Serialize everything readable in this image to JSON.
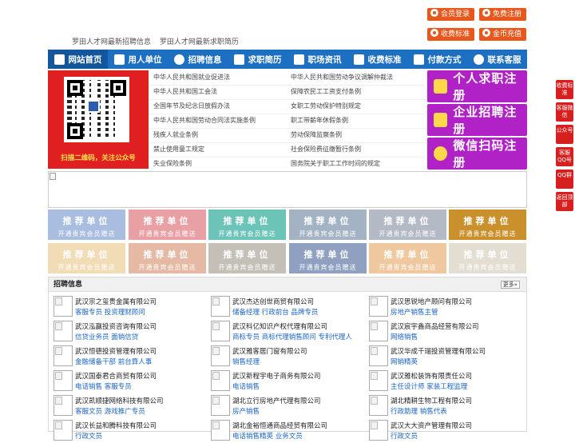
{
  "top": {
    "links": [
      "罗田人才网最新招聘信息",
      "罗田人才网最新求职简历"
    ],
    "buttons": {
      "member_login": "会员登录",
      "free_register": "免费注册",
      "pricing": "收费标准",
      "coin_recharge": "金币充值"
    }
  },
  "nav": {
    "items": [
      {
        "label": "网站首页",
        "icon": "home-icon"
      },
      {
        "label": "用人单位",
        "icon": "building-icon"
      },
      {
        "label": "招聘信息",
        "icon": "megaphone-icon"
      },
      {
        "label": "求职简历",
        "icon": "resume-icon"
      },
      {
        "label": "职场资讯",
        "icon": "news-icon"
      },
      {
        "label": "收费标准",
        "icon": "tag-icon"
      },
      {
        "label": "付款方式",
        "icon": "payment-icon"
      },
      {
        "label": "联系客服",
        "icon": "phone-icon"
      }
    ]
  },
  "qr": {
    "caption": "扫描二维码，关注公众号"
  },
  "laws": {
    "left": [
      "中华人民共和国就业促进法",
      "中华人民共和国工会法",
      "全国年节及纪念日放假办法",
      "中华人民共和国劳动合同法实施条例",
      "残疾人就业条例",
      "禁止使用童工规定",
      "失业保险条例"
    ],
    "right": [
      "中华人民共和国劳动争议调解仲裁法",
      "保障农民工工资支付条例",
      "女职工劳动保护特别规定",
      "职工带薪年休假条例",
      "劳动保障监察条例",
      "社会保险费征缴暂行条例",
      "国务院关于职工工作时间的规定"
    ]
  },
  "register": {
    "personal": "个人求职注册",
    "company": "企业招聘注册",
    "wechat": "微信扫码注册"
  },
  "recommend": {
    "title": "推荐单位",
    "subtitle": "开通贵宾会员赠送",
    "colors": [
      "#a9bde0",
      "#e8a0a4",
      "#6cc4b8",
      "#a3b3c4",
      "#b4b9c6",
      "#c9902c",
      "#f2dcb6",
      "#e5b9a4",
      "#c4c0b8",
      "#8fa0c0",
      "#f0c8a0",
      "#e4ddd2"
    ]
  },
  "jobs": {
    "header": "招聘信息",
    "more": "更多»",
    "columns": [
      [
        {
          "company": "武汉宗之玺贵金属有限公司",
          "positions": "客服专员 投资理财顾问"
        },
        {
          "company": "武汉泓赢投资咨询有限公司",
          "positions": "信贷业务员 面销信贷"
        },
        {
          "company": "武汉恒德投资管理有限公司",
          "positions": "金融储备干部 前台算人事"
        },
        {
          "company": "武汉国泰君合商贸有限公司",
          "positions": "电话销售 客服专员"
        },
        {
          "company": "武汉凯顺捷网络科技有限公司",
          "positions": "客服文员 游戏推广专员"
        },
        {
          "company": "武汉长益和腾科技有限公司",
          "positions": "行政文员"
        }
      ],
      [
        {
          "company": "武汉杰达创世商贸有限公司",
          "positions": "储备经理 行政前台 品牌专员"
        },
        {
          "company": "武汉科亿知识产权代理有限公司",
          "positions": "商标专员 商标代理销售顾问 专利代理人"
        },
        {
          "company": "武汉雅客居门窗有限公司",
          "positions": "销售经理"
        },
        {
          "company": "武汉新程宇电子商务有限公司",
          "positions": "电话销售"
        },
        {
          "company": "湖北立行房地产代理有限公司",
          "positions": "房产销售"
        },
        {
          "company": "湖北金裕恒通商品经贸有限公司",
          "positions": "电话销售精英 业务文员"
        }
      ],
      [
        {
          "company": "武汉思锐地产顾问有限公司",
          "positions": "房地产销售主管"
        },
        {
          "company": "武汉宸宇鑫商品经营有限公司",
          "positions": "网络销售"
        },
        {
          "company": "武汉华成千瑞投资管理有限公司",
          "positions": "网销精英"
        },
        {
          "company": "武汉雅松装饰有限责任公司",
          "positions": "主任设计师 家装工程监理"
        },
        {
          "company": "湖北精耕生物工程有限公司",
          "positions": "行政助理 销售代表"
        },
        {
          "company": "武汉大大资产管理有限公司",
          "positions": "行政文员"
        }
      ]
    ]
  },
  "side": [
    "收费标准",
    "客服微信",
    "公众号",
    "客服QQ号",
    "QQ群",
    "返回顶部"
  ]
}
